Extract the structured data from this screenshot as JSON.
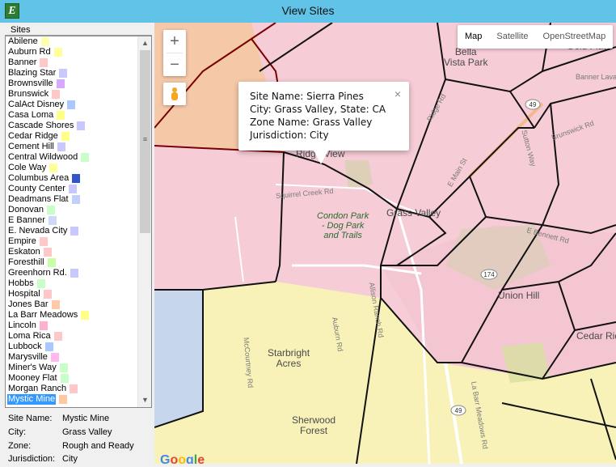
{
  "window": {
    "title": "View Sites",
    "icon": "app-e-icon"
  },
  "sites_panel": {
    "header": "Sites",
    "items": [
      {
        "label": "Abilene",
        "color": "#ffffb0"
      },
      {
        "label": "Auburn Rd",
        "color": "#ffff99"
      },
      {
        "label": "Banner",
        "color": "#ffc8c8"
      },
      {
        "label": "Blazing Star",
        "color": "#c8c8ff"
      },
      {
        "label": "Brownsville",
        "color": "#d8a8ff"
      },
      {
        "label": "Brunswick",
        "color": "#ffc8c8"
      },
      {
        "label": "CalAct Disney",
        "color": "#a8c8ff"
      },
      {
        "label": "Casa Loma",
        "color": "#ffff88"
      },
      {
        "label": "Cascade Shores",
        "color": "#c8c8ff"
      },
      {
        "label": "Cedar Ridge",
        "color": "#ffff88"
      },
      {
        "label": "Cement Hill",
        "color": "#c8c8ff"
      },
      {
        "label": "Central Wildwood",
        "color": "#c8ffc8"
      },
      {
        "label": "Cole Way",
        "color": "#ffff99"
      },
      {
        "label": "Columbus Area",
        "color": "#3355cc"
      },
      {
        "label": "County Center",
        "color": "#c8c8ff"
      },
      {
        "label": "Deadmans Flat",
        "color": "#c0d0f8"
      },
      {
        "label": "Donovan",
        "color": "#c8ffc8"
      },
      {
        "label": "E Banner",
        "color": "#d0d8f8"
      },
      {
        "label": "E. Nevada City",
        "color": "#c8c8ff"
      },
      {
        "label": "Empire",
        "color": "#ffc8c8"
      },
      {
        "label": "Eskaton",
        "color": "#ffc8c8"
      },
      {
        "label": "Foresthill",
        "color": "#c8ffa8"
      },
      {
        "label": "Greenhorn Rd.",
        "color": "#c8c8ff"
      },
      {
        "label": "Hobbs",
        "color": "#c8ffc8"
      },
      {
        "label": "Hospital",
        "color": "#ffc8c8"
      },
      {
        "label": "Jones Bar",
        "color": "#ffc8a8"
      },
      {
        "label": "La Barr Meadows",
        "color": "#ffff88"
      },
      {
        "label": "Lincoln",
        "color": "#ffb0d0"
      },
      {
        "label": "Loma Rica",
        "color": "#ffc8c8"
      },
      {
        "label": "Lubbock",
        "color": "#a8c8ff"
      },
      {
        "label": "Marysville",
        "color": "#ffb8f0"
      },
      {
        "label": "Miner's Way",
        "color": "#c8ffc8"
      },
      {
        "label": "Mooney Flat",
        "color": "#c8ffc8"
      },
      {
        "label": "Morgan Ranch",
        "color": "#ffc8c8"
      },
      {
        "label": "Mystic Mine",
        "color": "#ffc8a0",
        "selected": true
      }
    ]
  },
  "details": {
    "site_name_label": "Site Name:",
    "site_name": "Mystic Mine",
    "city_label": "City:",
    "city": "Grass Valley",
    "zone_label": "Zone:",
    "zone": "Rough and Ready",
    "jurisdiction_label": "Jurisdiction:",
    "jurisdiction": "City"
  },
  "map": {
    "zoom_in": "+",
    "zoom_out": "−",
    "types": [
      "Map",
      "Satellite",
      "OpenStreetMap"
    ],
    "active_type": "Map",
    "infowindow": {
      "line1": "Site Name: Sierra Pines",
      "line2": "City: Grass Valley, State: CA",
      "line3": "Zone Name: Grass Valley",
      "line4": "Jurisdiction: City",
      "close": "×"
    },
    "places": {
      "bella_vista": "Bella\nVista Park",
      "condon_park": "Condon Park\n- Dog Park\nand Trails",
      "grass_valley": "Grass Valley",
      "union_hill": "Union Hill",
      "cedar_ridge": "Cedar Ridge",
      "starbright": "Starbright\nAcres",
      "sherwood": "Sherwood\nForest",
      "ridge_view": "Ridge View",
      "gold_flat": "Gold Flat"
    },
    "roads": {
      "brunswick": "Brunswick Rd",
      "banner_lava": "Banner Lava",
      "sutton": "Sutton Way",
      "e_bennett": "E Bennett Rd",
      "squirrel_creek": "Squirrel Creek Rd",
      "ridge_rd": "Ridge Rd",
      "e_main": "E Main St",
      "auburn_rd": "Auburn Rd",
      "mccourtney": "McCourtney Rd",
      "allison_ranch": "Allison Ranch Rd",
      "la_barr": "La Barr Meadows Rd",
      "hwy49": "49",
      "hwy174": "174"
    },
    "logo": "Google"
  }
}
